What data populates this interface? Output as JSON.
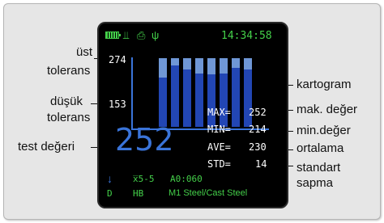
{
  "status": {
    "time": "14:34:58",
    "icons": [
      "battery-icon",
      "probe-icon",
      "printer-icon",
      "usb-icon"
    ]
  },
  "chart": {
    "upper_tol": "274",
    "lower_tol": "153",
    "bars": [
      {
        "value": 0.72
      },
      {
        "value": 0.9
      },
      {
        "value": 0.83
      },
      {
        "value": 0.78
      },
      {
        "value": 0.76
      },
      {
        "value": 0.78
      },
      {
        "value": 0.86
      },
      {
        "value": 0.84
      }
    ]
  },
  "reading": {
    "test_value": "252",
    "stats": {
      "max_label": "MAX=",
      "max_value": "252",
      "min_label": "MIN=",
      "min_value": "214",
      "ave_label": "AVE=",
      "ave_value": "230",
      "std_label": "STD=",
      "std_value": "14"
    }
  },
  "footer": {
    "arrow": "↓",
    "xbar": "x̅5-5",
    "ao": "A0:060",
    "mode": "D",
    "scale": "HB",
    "material": "M1 Steel/Cast Steel"
  },
  "annotations": {
    "ust_tolerans_1": "üst",
    "ust_tolerans_2": "tolerans",
    "dusuk_tolerans_1": "düşük",
    "dusuk_tolerans_2": "tolerans",
    "test_degeri": "test değeri",
    "kartogram": "kartogram",
    "mak_deger": "mak. değer",
    "min_deger": "min.değer",
    "ortalama": "ortalama",
    "standart_sapma_1": "standart",
    "standart_sapma_2": "sapma"
  },
  "colors": {
    "screen_bg": "#000000",
    "text_green": "#44d04a",
    "text_blue": "#3a74d9",
    "bar_fill": "#2246b4",
    "bar_track": "#6f97d6",
    "card_bg": "#e6e6e6"
  }
}
